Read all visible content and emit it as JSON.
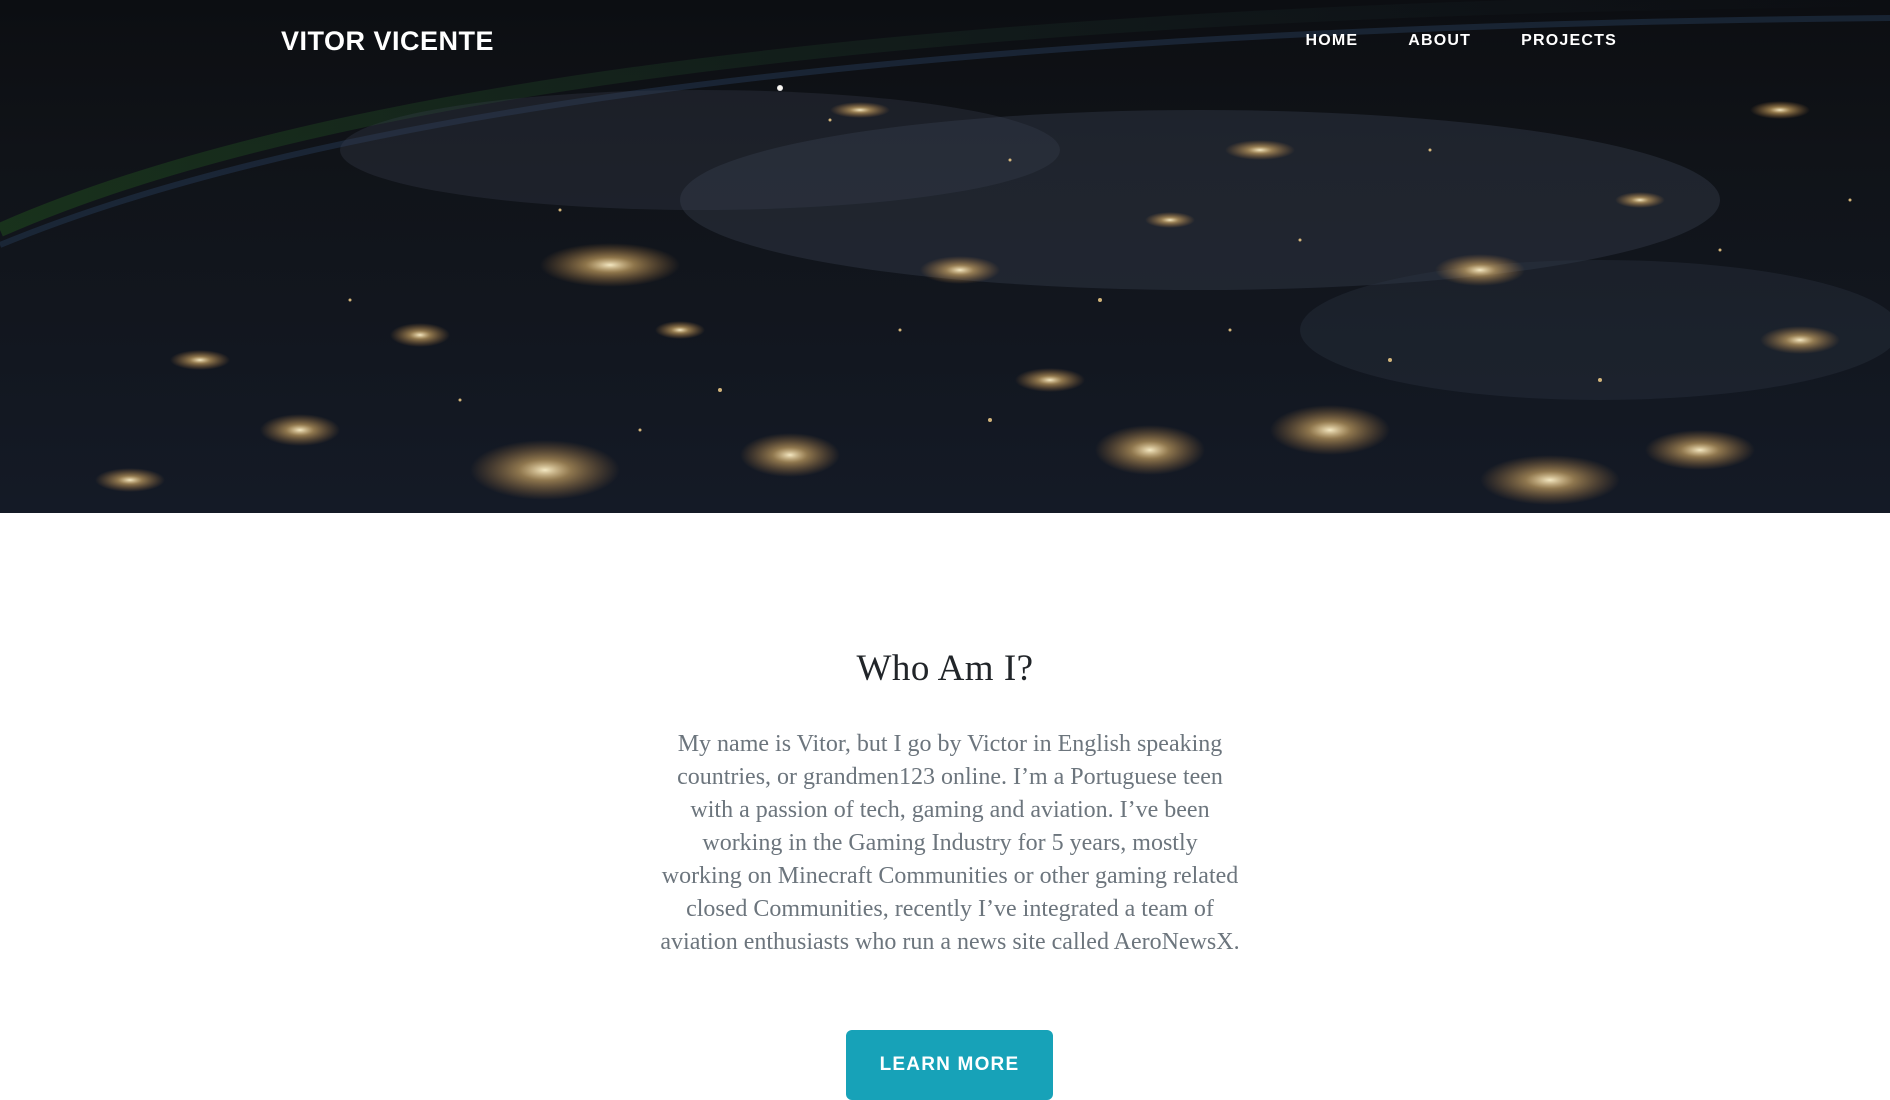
{
  "header": {
    "brand": "VITOR VICENTE",
    "nav": [
      {
        "label": "HOME"
      },
      {
        "label": "ABOUT"
      },
      {
        "label": "PROJECTS"
      }
    ]
  },
  "hero": {
    "image_icon": "earth-at-night-image"
  },
  "about": {
    "title": "Who Am I?",
    "body": "My name is Vitor, but I go by Victor in English speaking countries, or grandmen123 online. I’m a Portuguese teen with a passion of tech, gaming and aviation. I’ve been working in the Gaming Industry for 5 years, mostly working on Minecraft Communities or other gaming related closed Communities, recently I’ve integrated a team of aviation enthusiasts who run a news site called AeroNewsX.",
    "button_label": "LEARN MORE"
  },
  "colors": {
    "accent": "#17a2b8",
    "heading": "#212529",
    "body_text": "#6c757d"
  }
}
